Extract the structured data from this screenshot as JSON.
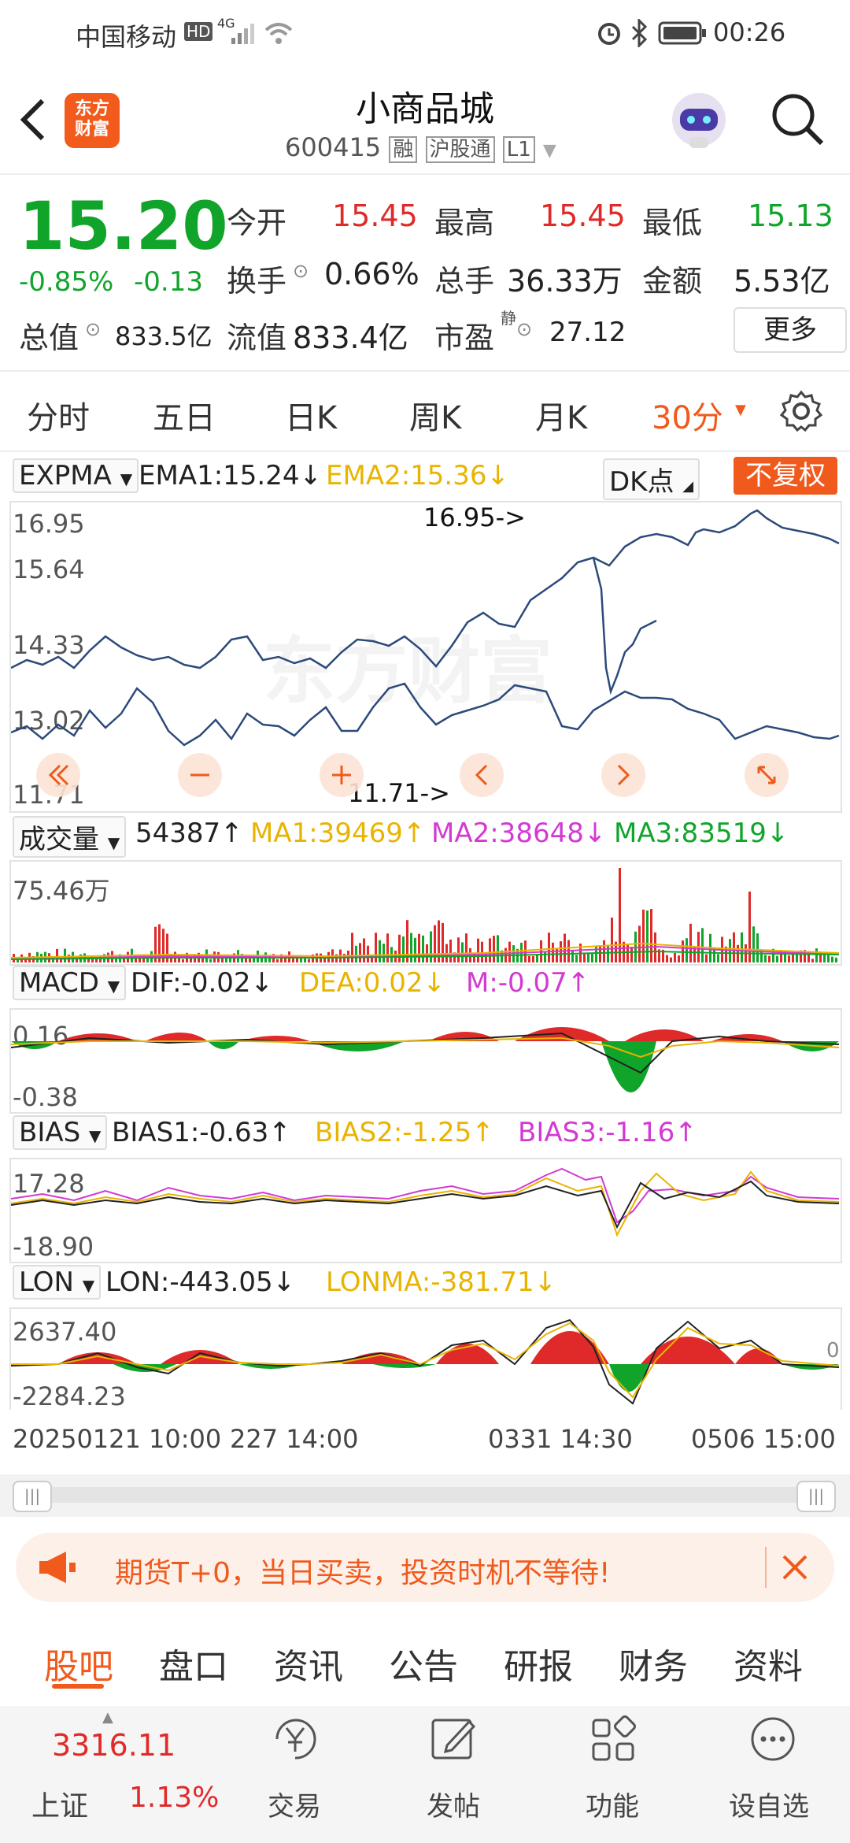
{
  "status_bar": {
    "carrier": "中国移动",
    "hd": "HD",
    "net": "4G",
    "time": "00:26"
  },
  "header": {
    "title": "小商品城",
    "code": "600415",
    "tags": [
      "融",
      "沪股通",
      "L1"
    ],
    "logo_text": "东方\n财富"
  },
  "quote": {
    "price": "15.20",
    "change_pct": "-0.85%",
    "change": "-0.13",
    "open_label": "今开",
    "open": "15.45",
    "high_label": "最高",
    "high": "15.45",
    "low_label": "最低",
    "low": "15.13",
    "turnover_label": "换手",
    "turnover": "0.66%",
    "volume_label": "总手",
    "volume": "36.33万",
    "amount_label": "金额",
    "amount": "5.53亿",
    "mktcap_label": "总值",
    "mktcap": "833.5亿",
    "float_label": "流值",
    "float": "833.4亿",
    "pe_label": "市盈",
    "pe_sup": "静",
    "pe": "27.12",
    "more_button": "更多"
  },
  "period_tabs": [
    "分时",
    "五日",
    "日K",
    "周K",
    "月K"
  ],
  "period_active": "30分",
  "main_chart": {
    "indicator": "EXPMA",
    "ema1": "EMA1:15.24↓",
    "ema2": "EMA2:15.36↓",
    "dk_button": "DK点",
    "fuquan_button": "不复权",
    "y_ticks": [
      "16.95",
      "15.64",
      "14.33",
      "13.02",
      "11.71"
    ],
    "max_label": "16.95->",
    "min_label": "11.71->",
    "watermark": "东方财富"
  },
  "volume_panel": {
    "indicator": "成交量",
    "vol": "54387↑",
    "ma1": "MA1:39469↑",
    "ma2": "MA2:38648↓",
    "ma3": "MA3:83519↓",
    "y_max": "75.46万"
  },
  "macd_panel": {
    "indicator": "MACD",
    "dif": "DIF:-0.02↓",
    "dea": "DEA:0.02↓",
    "m": "M:-0.07↑",
    "y_max": "0.16",
    "y_min": "-0.38"
  },
  "bias_panel": {
    "indicator": "BIAS",
    "b1": "BIAS1:-0.63↑",
    "b2": "BIAS2:-1.25↑",
    "b3": "BIAS3:-1.16↑",
    "y_max": "17.28",
    "y_min": "-18.90"
  },
  "lon_panel": {
    "indicator": "LON",
    "lon": "LON:-443.05↓",
    "lonma": "LONMA:-381.71↓",
    "y_max": "2637.40",
    "y_min": "-2284.23",
    "right_zero": "0"
  },
  "x_axis": [
    "20250121 10:00",
    "227 14:00",
    "0331 14:30",
    "0506 15:00"
  ],
  "banner": {
    "text": "期货T+0，当日买卖，投资时机不等待!"
  },
  "bottom_tabs": [
    "股吧",
    "盘口",
    "资讯",
    "公告",
    "研报",
    "财务",
    "资料"
  ],
  "bottom_nav": {
    "index_value": "3316.11",
    "index_name": "上证",
    "index_change": "1.13%",
    "items": [
      "交易",
      "发帖",
      "功能",
      "设自选"
    ]
  },
  "colors": {
    "red": "#e02a2a",
    "green": "#10a52a",
    "orange": "#f05a1c",
    "yellow": "#e8b400",
    "magenta": "#d23ad2",
    "blue": "#2c4a7a"
  }
}
